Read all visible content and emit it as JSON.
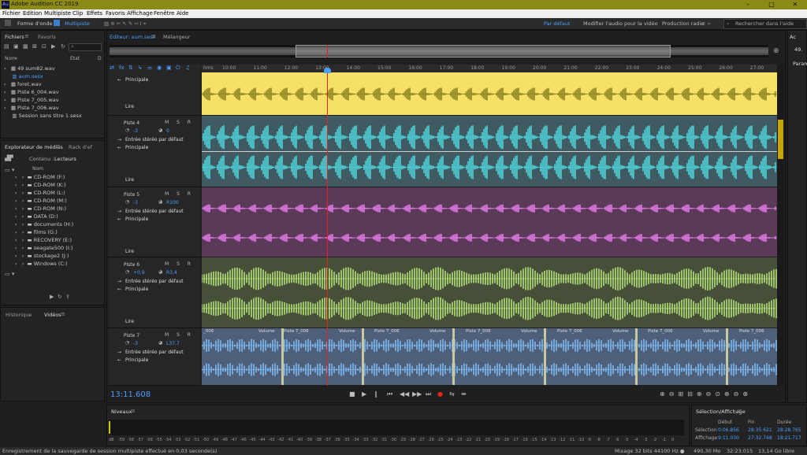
{
  "app": {
    "title": "Adobe Audition CC 2019",
    "window_buttons": [
      "–",
      "□",
      "✕"
    ]
  },
  "menu": [
    "Fichier",
    "Edition",
    "Multipiste",
    "Clip",
    "Effets",
    "Favoris",
    "Affichage",
    "Fenêtre",
    "Aide"
  ],
  "toolbar": {
    "mode_waveform": "Forme d'onde",
    "mode_multitrack": "Multipiste",
    "workspace_default": "Par défaut",
    "workspace_video": "Modifier l'audio pour la vidéo",
    "workspace_radio": "Production radio",
    "search_placeholder": "Rechercher dans l'aide"
  },
  "files_panel": {
    "tab_files": "Fichiers",
    "tab_favorites": "Favoris",
    "col_name": "Nom",
    "col_state": "Etat",
    "col_d": "D",
    "items": [
      "49 sum82.wav",
      "aum.sesx",
      "foret.wav",
      "Piste 6_004.wav",
      "Piste 7_005.wav",
      "Piste 7_006.wav",
      "Session sans titre 1.sesx"
    ]
  },
  "media_panel": {
    "tab_media": "Explorateur de médias",
    "tab_rack": "Rack d'ef",
    "content_label": "Contenu :",
    "drives_label": "Lecteurs",
    "col_name": "Nom",
    "items": [
      "CD-ROM (F:)",
      "CD-ROM (K:)",
      "CD-ROM (L:)",
      "CD-ROM (M:)",
      "CD-ROM (N:)",
      "DATA (D:)",
      "documents (H:)",
      "films (G:)",
      "RECOVERY (E:)",
      "seagate500 (I:)",
      "stockage2 (J:)",
      "Windows (C:)"
    ]
  },
  "bottom_left_tabs": {
    "history": "Historique",
    "videos": "Vidéos"
  },
  "editor": {
    "tab_editor": "Editeur: aum.sesx",
    "tab_mixer": "Mélangeur",
    "time": "13:11.608",
    "ruler_first": "hms",
    "ruler": [
      "10:00",
      "11:00",
      "12:00",
      "13:00",
      "14:00",
      "15:00",
      "16:00",
      "17:00",
      "18:00",
      "19:00",
      "20:00",
      "21:00",
      "22:00",
      "23:00",
      "24:00",
      "25:00",
      "26:00",
      "27:00"
    ]
  },
  "tracks": [
    {
      "name": "",
      "vol": "",
      "pan": "",
      "input": "",
      "output": "Principale",
      "read": "Lire",
      "color": "#f7e066",
      "wave": "#8c8420",
      "stripe": "#e8c800"
    },
    {
      "name": "Piste 4",
      "vol": "-3",
      "pan": "0",
      "input": "Entrée stéréo par défaut",
      "output": "Principale",
      "read": "Lire",
      "color": "#3f5a60",
      "wave": "#4fd0d8",
      "stripe": "#2a8a90"
    },
    {
      "name": "Piste 5",
      "vol": "-3",
      "pan": "R100",
      "input": "Entrée stéréo par défaut",
      "output": "Principale",
      "read": "Lire",
      "color": "#5a3a58",
      "wave": "#e27ae6",
      "stripe": "#a040a8"
    },
    {
      "name": "Piste 6",
      "vol": "+0,9",
      "pan": "R3,4",
      "input": "Entrée stéréo par défaut",
      "output": "Principale",
      "read": "Lire",
      "color": "#465039",
      "wave": "#b4e07a",
      "stripe": "#6a9a30"
    },
    {
      "name": "Piste 7",
      "vol": "-3",
      "pan": "L37,7",
      "input": "Entrée stéréo par défaut",
      "output": "Principale",
      "read": "",
      "color": "#4e5f7a",
      "wave": "#7fb8f0",
      "stripe": "#3a6ac0"
    }
  ],
  "clips_track7": {
    "clip_name": "Piste 7_006",
    "clip_short": "_006",
    "volume_label": "Volume"
  },
  "track_buttons": "M S R",
  "levels": {
    "title": "Niveaux",
    "scale": [
      "dB",
      "-59",
      "-58",
      "-57",
      "-56",
      "-55",
      "-54",
      "-53",
      "-52",
      "-51",
      "-50",
      "-49",
      "-48",
      "-47",
      "-46",
      "-45",
      "-44",
      "-43",
      "-42",
      "-41",
      "-40",
      "-39",
      "-38",
      "-37",
      "-36",
      "-35",
      "-34",
      "-33",
      "-32",
      "-31",
      "-30",
      "-29",
      "-28",
      "-27",
      "-26",
      "-25",
      "-24",
      "-23",
      "-22",
      "-21",
      "-20",
      "-19",
      "-18",
      "-17",
      "-16",
      "-15",
      "-14",
      "-13",
      "-12",
      "-11",
      "-10",
      "-9",
      "-8",
      "-7",
      "-6",
      "-5",
      "-4",
      "-3",
      "-2",
      "-1",
      "0"
    ]
  },
  "selection": {
    "title": "Sélection/Affichage",
    "col_start": "Début",
    "col_end": "Fin",
    "col_duration": "Durée",
    "row_selection": "Sélection",
    "row_view": "Affichage",
    "sel_start": "0:06.856",
    "sel_end": "28:35.621",
    "sel_duration": "28:28.765",
    "view_start": "9:11.030",
    "view_end": "27:32.748",
    "view_duration": "18:21.717"
  },
  "status": {
    "message": "Enregistrement de la sauvegarde de session multipiste effectué en 0,03 seconde(s)",
    "format": "Mixage 32 bits 44100 Hz ●",
    "memory": "490,30 Mo",
    "duration": "32:23.015",
    "free": "13,14 Go libre"
  },
  "right_panel": {
    "label1": "Ac",
    "label2": "49.",
    "label3": "Param"
  },
  "colors": {
    "playhead": "#e82020",
    "accent": "#4a9fff"
  }
}
